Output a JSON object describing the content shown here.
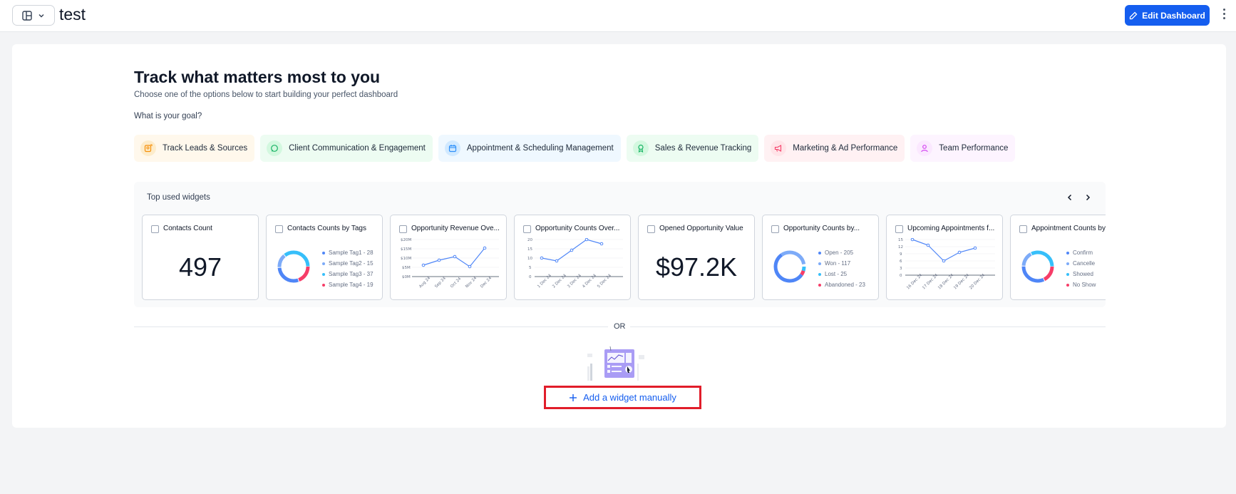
{
  "header": {
    "title": "test",
    "edit_label": "Edit Dashboard"
  },
  "intro": {
    "headline": "Track what matters most to you",
    "subline": "Choose one of the options below to start building your perfect dashboard",
    "question": "What is your goal?"
  },
  "goals": [
    {
      "label": "Track Leads & Sources",
      "icon": "lead-icon",
      "bg": "#fff8ec",
      "accent": "#f79009"
    },
    {
      "label": "Client Communication & Engagement",
      "icon": "chat-icon",
      "bg": "#edfcf2",
      "accent": "#16b364"
    },
    {
      "label": "Appointment & Scheduling Management",
      "icon": "calendar-icon",
      "bg": "#eff8ff",
      "accent": "#2e90fa"
    },
    {
      "label": "Sales & Revenue Tracking",
      "icon": "award-icon",
      "bg": "#edfcf2",
      "accent": "#16b364"
    },
    {
      "label": "Marketing & Ad Performance",
      "icon": "megaphone-icon",
      "bg": "#fff1f3",
      "accent": "#f63d68"
    },
    {
      "label": "Team Performance",
      "icon": "user-icon",
      "bg": "#fdf4ff",
      "accent": "#d444f1"
    }
  ],
  "widgets": {
    "title": "Top used widgets",
    "cards": [
      {
        "title": "Contacts Count",
        "type": "number",
        "value": "497"
      },
      {
        "title": "Contacts Counts by Tags",
        "type": "donut",
        "legend": [
          "Sample Tag1 - 28",
          "Sample Tag2 - 15",
          "Sample Tag3 - 37",
          "Sample Tag4 - 19"
        ],
        "legend_colors": [
          "#4f86f7",
          "#7dabf8",
          "#36bffa",
          "#f63d68"
        ]
      },
      {
        "title": "Opportunity Revenue Ove...",
        "type": "line",
        "chart_data": {
          "type": "line",
          "categories": [
            "Aug 24",
            "Sep 24",
            "Oct 24",
            "Nov 24",
            "Dec 24"
          ],
          "values_labels": [
            "$20M",
            "$15M",
            "$10M",
            "$5M",
            "$0M"
          ],
          "points": [
            [
              0,
              0.3
            ],
            [
              0.5,
              0.45
            ],
            [
              1,
              0.55
            ],
            [
              1.5,
              0.25
            ],
            [
              2,
              0.8
            ]
          ]
        }
      },
      {
        "title": "Opportunity Counts Over...",
        "type": "line",
        "chart_data": {
          "type": "line",
          "categories": [
            "1 Dec 24",
            "2 Dec 24",
            "3 Dec 24",
            "4 Dec 24",
            "5 Dec 24"
          ],
          "values_labels": [
            "20",
            "15",
            "10",
            "5",
            "0"
          ]
        }
      },
      {
        "title": "Opened Opportunity Value",
        "type": "number",
        "value": "$97.2K"
      },
      {
        "title": "Opportunity Counts by...",
        "type": "donut",
        "legend": [
          "Open - 205",
          "Won - 117",
          "Lost - 25",
          "Abandoned - 23"
        ],
        "legend_colors": [
          "#4f86f7",
          "#7dabf8",
          "#36bffa",
          "#f63d68"
        ]
      },
      {
        "title": "Upcoming Appointments f...",
        "type": "line",
        "chart_data": {
          "type": "line",
          "categories": [
            "16 Dec 24",
            "17 Dec 24",
            "18 Dec 24",
            "19 Dec 24",
            "20 Dec 24"
          ],
          "values_labels": [
            "15",
            "12",
            "9",
            "6",
            "3",
            "0"
          ]
        }
      },
      {
        "title": "Appointment Counts by...",
        "type": "donut",
        "legend": [
          "Confirm",
          "Cancelle",
          "Showed",
          "No Show"
        ],
        "legend_colors": [
          "#4f86f7",
          "#7dabf8",
          "#36bffa",
          "#f63d68"
        ]
      }
    ]
  },
  "divider": {
    "text": "OR"
  },
  "add_widget": {
    "label": "Add a widget manually"
  }
}
